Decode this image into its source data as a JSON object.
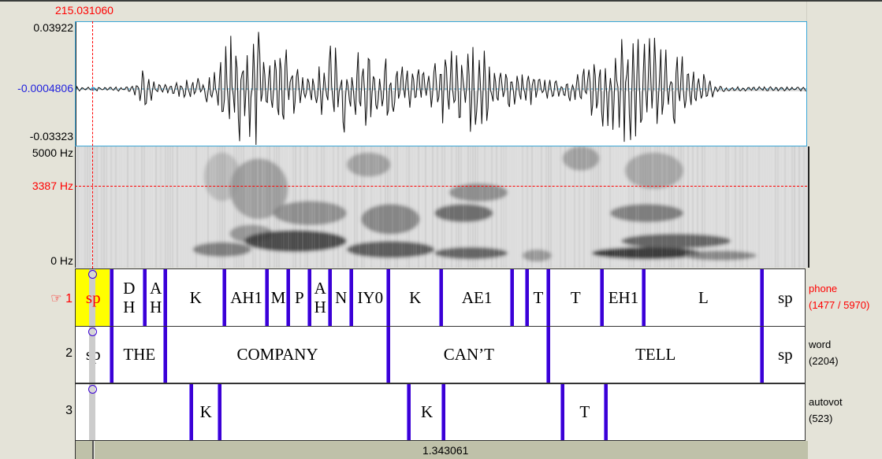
{
  "cursor": {
    "time": "215.031060"
  },
  "waveform": {
    "y_max": "0.03922",
    "y_cursor": "-0.0004806",
    "y_min": "-0.03323"
  },
  "spectrogram": {
    "freq_max": "5000 Hz",
    "freq_cursor": "3387 Hz",
    "freq_min": "0 Hz",
    "freq_cursor_fraction": 0.677
  },
  "tiers": [
    {
      "number": "1",
      "pointer_icon": "☞",
      "name": "phone",
      "count": "(1477 / 5970)",
      "active": true,
      "intervals": [
        {
          "label": "sp",
          "start": 0.0,
          "end": 0.048,
          "selected": true
        },
        {
          "label": [
            "D",
            "H"
          ],
          "start": 0.048,
          "end": 0.093
        },
        {
          "label": [
            "A",
            "H"
          ],
          "start": 0.093,
          "end": 0.121
        },
        {
          "label": "K",
          "start": 0.121,
          "end": 0.202
        },
        {
          "label": "AH1",
          "start": 0.202,
          "end": 0.26
        },
        {
          "label": "M",
          "start": 0.26,
          "end": 0.289
        },
        {
          "label": "P",
          "start": 0.289,
          "end": 0.318
        },
        {
          "label": [
            "A",
            "H"
          ],
          "start": 0.318,
          "end": 0.346
        },
        {
          "label": "N",
          "start": 0.346,
          "end": 0.375
        },
        {
          "label": "IY0",
          "start": 0.375,
          "end": 0.426
        },
        {
          "label": "K",
          "start": 0.426,
          "end": 0.498
        },
        {
          "label": "AE1",
          "start": 0.498,
          "end": 0.595
        },
        {
          "label": "",
          "start": 0.595,
          "end": 0.616
        },
        {
          "label": "T",
          "start": 0.616,
          "end": 0.645
        },
        {
          "label": "T",
          "start": 0.645,
          "end": 0.718
        },
        {
          "label": "EH1",
          "start": 0.718,
          "end": 0.776
        },
        {
          "label": "L",
          "start": 0.776,
          "end": 0.937
        },
        {
          "label": "sp",
          "start": 0.937,
          "end": 1.0
        }
      ]
    },
    {
      "number": "2",
      "name": "word",
      "count": "(2204)",
      "active": false,
      "intervals": [
        {
          "label": "sp",
          "start": 0.0,
          "end": 0.048
        },
        {
          "label": "THE",
          "start": 0.048,
          "end": 0.121
        },
        {
          "label": "COMPANY",
          "start": 0.121,
          "end": 0.426
        },
        {
          "label": "CAN’T",
          "start": 0.426,
          "end": 0.645
        },
        {
          "label": "TELL",
          "start": 0.645,
          "end": 0.937
        },
        {
          "label": "sp",
          "start": 0.937,
          "end": 1.0
        }
      ]
    },
    {
      "number": "3",
      "name": "autovot",
      "count": "(523)",
      "active": false,
      "intervals": [
        {
          "label": "",
          "start": 0.0,
          "end": 0.156
        },
        {
          "label": "K",
          "start": 0.156,
          "end": 0.195
        },
        {
          "label": "",
          "start": 0.195,
          "end": 0.454
        },
        {
          "label": "K",
          "start": 0.454,
          "end": 0.502
        },
        {
          "label": "",
          "start": 0.502,
          "end": 0.664
        },
        {
          "label": "T",
          "start": 0.664,
          "end": 0.724
        },
        {
          "label": "",
          "start": 0.724,
          "end": 1.0
        }
      ]
    }
  ],
  "visible_duration": "1.343061",
  "colors": {
    "boundary": "#3b00d6",
    "selection": "#ffff00",
    "cursor": "#ff0000",
    "active_tier_text": "#ff0000"
  }
}
